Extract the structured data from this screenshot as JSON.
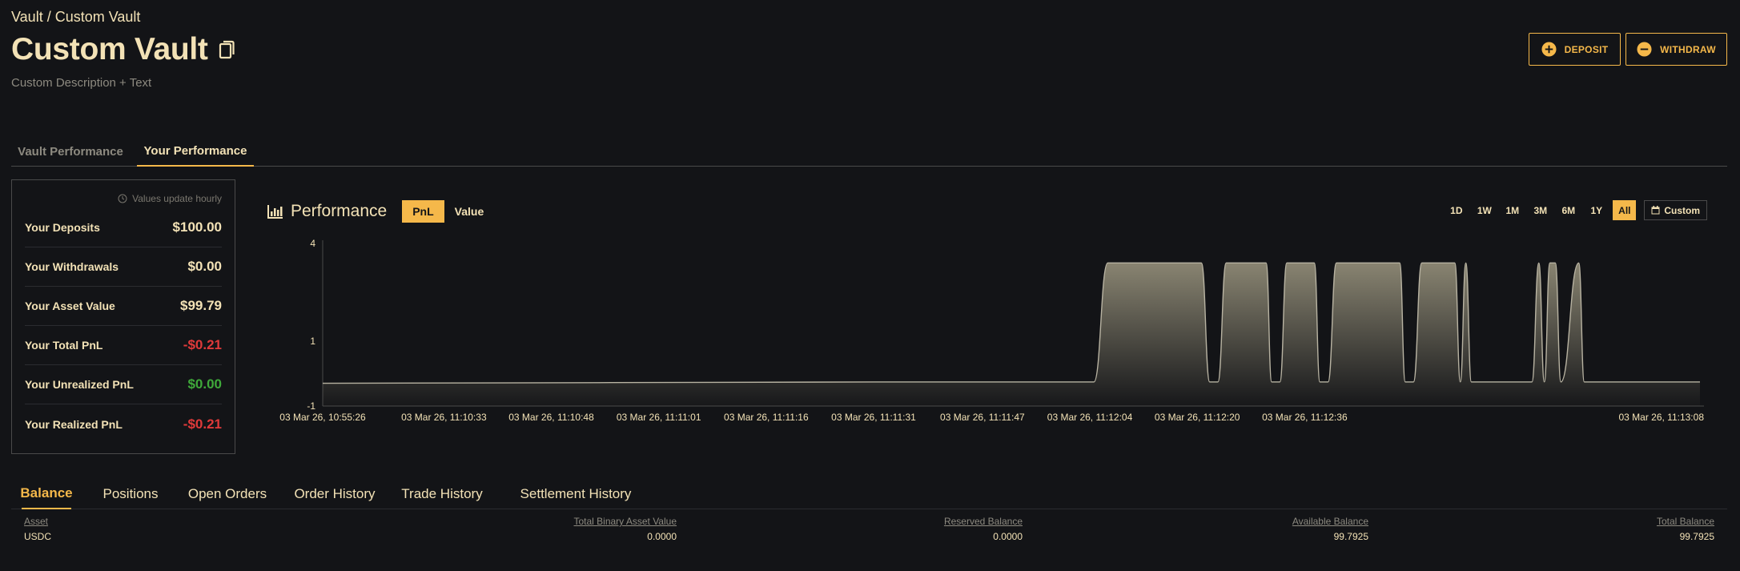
{
  "breadcrumb": "Vault / Custom Vault",
  "header": {
    "title": "Custom Vault",
    "description": "Custom Description + Text",
    "deposit_label": "DEPOSIT",
    "withdraw_label": "WITHDRAW"
  },
  "tabs": [
    {
      "label": "Vault Performance",
      "active": false
    },
    {
      "label": "Your Performance",
      "active": true
    }
  ],
  "stats": {
    "note": "Values update hourly",
    "rows": [
      {
        "label": "Your Deposits",
        "value": "$100.00",
        "tone": "default"
      },
      {
        "label": "Your Withdrawals",
        "value": "$0.00",
        "tone": "default"
      },
      {
        "label": "Your Asset Value",
        "value": "$99.79",
        "tone": "default"
      },
      {
        "label": "Your Total PnL",
        "value": "-$0.21",
        "tone": "negative"
      },
      {
        "label": "Your Unrealized PnL",
        "value": "$0.00",
        "tone": "positive"
      },
      {
        "label": "Your Realized PnL",
        "value": "-$0.21",
        "tone": "negative"
      }
    ]
  },
  "performance": {
    "title": "Performance",
    "toggle_pnl": "PnL",
    "toggle_value": "Value",
    "ranges": [
      "1D",
      "1W",
      "1M",
      "3M",
      "6M",
      "1Y",
      "All"
    ],
    "active_range": "All",
    "custom_label": "Custom"
  },
  "chart_data": {
    "type": "area",
    "y_ticks": [
      "4",
      "1",
      "-1"
    ],
    "ylim": [
      -1,
      4
    ],
    "x_labels": [
      "03 Mar 26, 10:55:26",
      "03 Mar 26, 11:10:33",
      "03 Mar 26, 11:10:48",
      "03 Mar 26, 11:11:01",
      "03 Mar 26, 11:11:16",
      "03 Mar 26, 11:11:31",
      "03 Mar 26, 11:11:47",
      "03 Mar 26, 11:12:04",
      "03 Mar 26, 11:12:20",
      "03 Mar 26, 11:12:36",
      "03 Mar 26, 11:13:08"
    ],
    "series": [
      {
        "x": [
          0,
          0.4,
          0.56,
          0.57,
          0.576,
          0.638,
          0.644,
          0.65,
          0.656,
          0.66,
          0.685,
          0.689,
          0.695,
          0.7,
          0.704,
          0.72,
          0.724,
          0.73,
          0.736,
          0.74,
          0.782,
          0.786,
          0.792,
          0.798,
          0.802,
          0.822,
          0.826,
          0.83,
          0.834,
          0.839,
          0.842,
          0.878,
          0.883,
          0.887,
          0.891,
          0.895,
          0.899,
          0.912,
          0.916,
          0.92,
          0.924,
          0.93,
          0.934,
          0.938,
          1
        ],
        "y": [
          -0.3,
          -0.26,
          -0.26,
          3.4,
          3.4,
          3.4,
          -0.26,
          -0.26,
          3.4,
          3.4,
          3.4,
          -0.26,
          -0.26,
          3.4,
          3.4,
          3.4,
          -0.26,
          -0.26,
          3.4,
          3.4,
          3.4,
          -0.26,
          -0.26,
          3.4,
          3.4,
          3.4,
          -0.26,
          3.4,
          -0.26,
          -0.26,
          -0.26,
          -0.26,
          3.4,
          -0.26,
          3.4,
          3.4,
          -0.26,
          3.4,
          -0.26,
          -0.26,
          -0.26,
          -0.26,
          -0.26,
          -0.26,
          -0.26
        ]
      }
    ]
  },
  "bottom_tabs": [
    {
      "label": "Balance",
      "active": true
    },
    {
      "label": "Positions",
      "active": false
    },
    {
      "label": "Open Orders",
      "active": false
    },
    {
      "label": "Order History",
      "active": false
    },
    {
      "label": "Trade History",
      "active": false
    },
    {
      "label": "Settlement History",
      "active": false
    }
  ],
  "balance_table": {
    "headers": [
      "Asset",
      "Total Binary Asset Value",
      "Reserved Balance",
      "Available Balance",
      "Total Balance"
    ],
    "rows": [
      [
        "USDC",
        "0.0000",
        "0.0000",
        "99.7925",
        "99.7925"
      ]
    ]
  }
}
